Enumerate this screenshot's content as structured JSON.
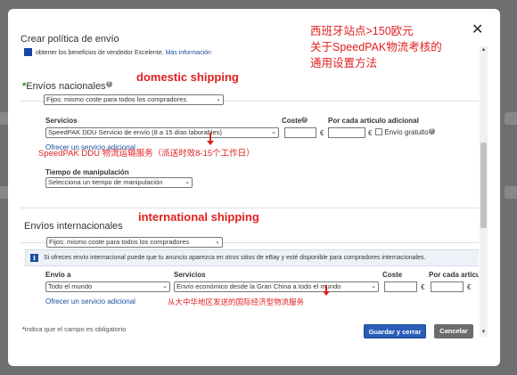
{
  "dialog": {
    "title": "Crear política de envío",
    "close_label": "✕"
  },
  "top_note": "obtener los beneficios de vendedor Excelente.",
  "top_link": "Más información",
  "domestic": {
    "title": "Envíos nacionales",
    "type_select": "Fijos: mismo coste para todos los compradores",
    "col_services": "Servicios",
    "col_cost": "Coste",
    "col_each_additional": "Por cada artículo adicional",
    "service_select": "SpeedPAK DDU Servicio de envío (8 a 15 días laborables)",
    "currency1": "€",
    "currency2": "€",
    "free_shipping": "Envío gratuito",
    "offer_link": "Ofrecer un servicio adicional",
    "handling_label": "Tiempo de manipulación",
    "handling_select": "Selecciona un tiempo de manipulación"
  },
  "international": {
    "title": "Envíos internacionales",
    "type_select": "Fijos: mismo coste para todos los compradores",
    "info_text": "Si ofreces envío internacional puede que tu anuncio aparezca en otros sitios de eBay y esté disponible para compradores internacionales.",
    "col_ship_to": "Envío a",
    "col_services": "Servicios",
    "col_cost": "Coste",
    "col_each_additional": "Por cada artícu",
    "ship_to_select": "Todo el mundo",
    "service_select": "Envío económico desde la Gran China a todo el mundo",
    "currency1": "€",
    "currency2": "€",
    "offer_link": "Ofrecer un servicio adicional"
  },
  "footer": {
    "required_note": "indica que el campo es obligatorio",
    "save_label": "Guardar y cerrar",
    "cancel_label": "Cancelar"
  },
  "annotations": {
    "top_line1": "西班牙站点>150欧元",
    "top_line2": "关于SpeedPAK物流考核的",
    "top_line3": "通用设置方法",
    "domestic_tag": "domestic shipping",
    "domestic_service_note": "SpeedPAK DDU 物流运输服务（派送时效8-15个工作日）",
    "international_tag": "international shipping",
    "international_service_note": "从大中华地区发送的国际经济型物流服务"
  },
  "colors": {
    "annotation_red": "#e02020",
    "link_blue": "#1a4fa0",
    "primary_button": "#2a5db8"
  }
}
